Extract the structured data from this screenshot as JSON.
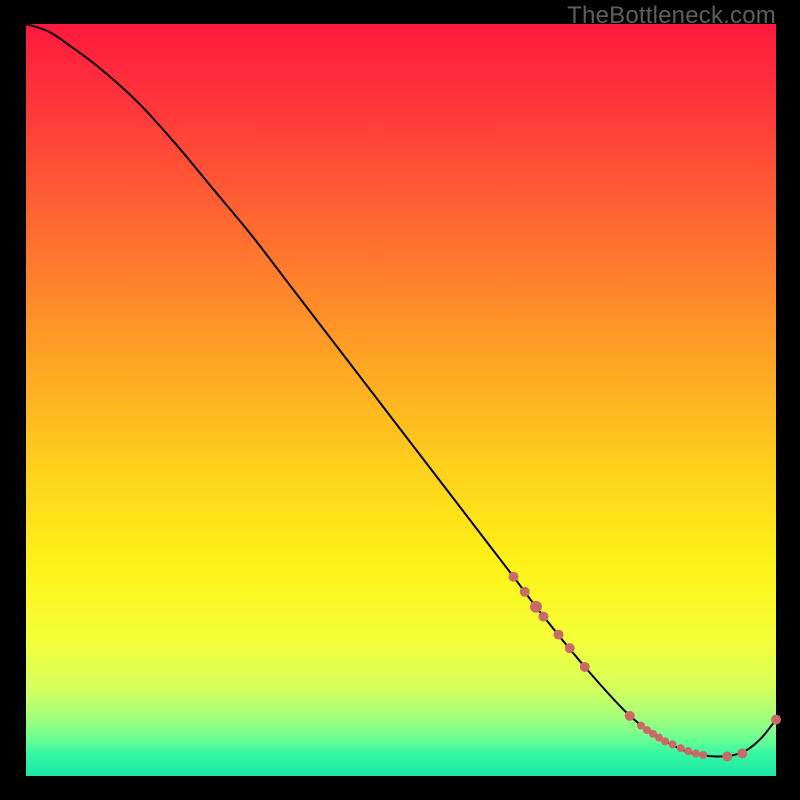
{
  "watermark": "TheBottleneck.com",
  "colors": {
    "curve": "#000000",
    "points": "#c96a68",
    "gradient_stops": [
      {
        "pct": 0,
        "color": "#ff1a3e"
      },
      {
        "pct": 12,
        "color": "#ff3a3a"
      },
      {
        "pct": 28,
        "color": "#ff6d30"
      },
      {
        "pct": 45,
        "color": "#ffa524"
      },
      {
        "pct": 60,
        "color": "#ffd31c"
      },
      {
        "pct": 72,
        "color": "#fff317"
      },
      {
        "pct": 82,
        "color": "#f4ff3a"
      },
      {
        "pct": 88,
        "color": "#d7ff5a"
      },
      {
        "pct": 92,
        "color": "#a8ff7a"
      },
      {
        "pct": 95,
        "color": "#6cff92"
      },
      {
        "pct": 97,
        "color": "#38f7a2"
      },
      {
        "pct": 100,
        "color": "#19e8a8"
      }
    ]
  },
  "chart_data": {
    "type": "line",
    "title": "",
    "xlabel": "",
    "ylabel": "",
    "xlim": [
      0,
      100
    ],
    "ylim": [
      0,
      100
    ],
    "grid": false,
    "legend": false,
    "series": [
      {
        "name": "bottleneck-curve",
        "x": [
          0,
          3,
          6,
          10,
          15,
          20,
          25,
          30,
          35,
          40,
          45,
          50,
          55,
          60,
          65,
          68,
          72,
          76,
          80,
          83,
          86,
          88,
          90,
          92,
          94,
          96,
          98,
          100
        ],
        "y": [
          100,
          99,
          97,
          94,
          89.5,
          84,
          78,
          72,
          65.5,
          59,
          52.5,
          46,
          39.5,
          33,
          26.5,
          22.5,
          17.5,
          12.8,
          8.5,
          6,
          4.2,
          3.3,
          2.8,
          2.6,
          2.7,
          3.4,
          5.0,
          7.5
        ]
      }
    ],
    "highlight_points": {
      "name": "highlighted-segment",
      "points": [
        {
          "x": 65.0,
          "y": 26.5,
          "r": 5
        },
        {
          "x": 66.5,
          "y": 24.5,
          "r": 5
        },
        {
          "x": 68.0,
          "y": 22.5,
          "r": 6
        },
        {
          "x": 69.0,
          "y": 21.2,
          "r": 5
        },
        {
          "x": 71.0,
          "y": 18.8,
          "r": 5
        },
        {
          "x": 72.5,
          "y": 17.0,
          "r": 5
        },
        {
          "x": 74.5,
          "y": 14.5,
          "r": 5
        },
        {
          "x": 80.5,
          "y": 8.0,
          "r": 5
        },
        {
          "x": 82.0,
          "y": 6.7,
          "r": 4
        },
        {
          "x": 82.8,
          "y": 6.1,
          "r": 4
        },
        {
          "x": 83.6,
          "y": 5.6,
          "r": 4
        },
        {
          "x": 84.4,
          "y": 5.1,
          "r": 4
        },
        {
          "x": 85.2,
          "y": 4.6,
          "r": 4
        },
        {
          "x": 86.2,
          "y": 4.2,
          "r": 4
        },
        {
          "x": 87.3,
          "y": 3.7,
          "r": 4
        },
        {
          "x": 88.3,
          "y": 3.3,
          "r": 4
        },
        {
          "x": 89.3,
          "y": 3.0,
          "r": 4
        },
        {
          "x": 90.3,
          "y": 2.8,
          "r": 4
        },
        {
          "x": 93.5,
          "y": 2.6,
          "r": 5
        },
        {
          "x": 95.5,
          "y": 3.0,
          "r": 5
        },
        {
          "x": 100.0,
          "y": 7.5,
          "r": 5
        }
      ]
    }
  }
}
